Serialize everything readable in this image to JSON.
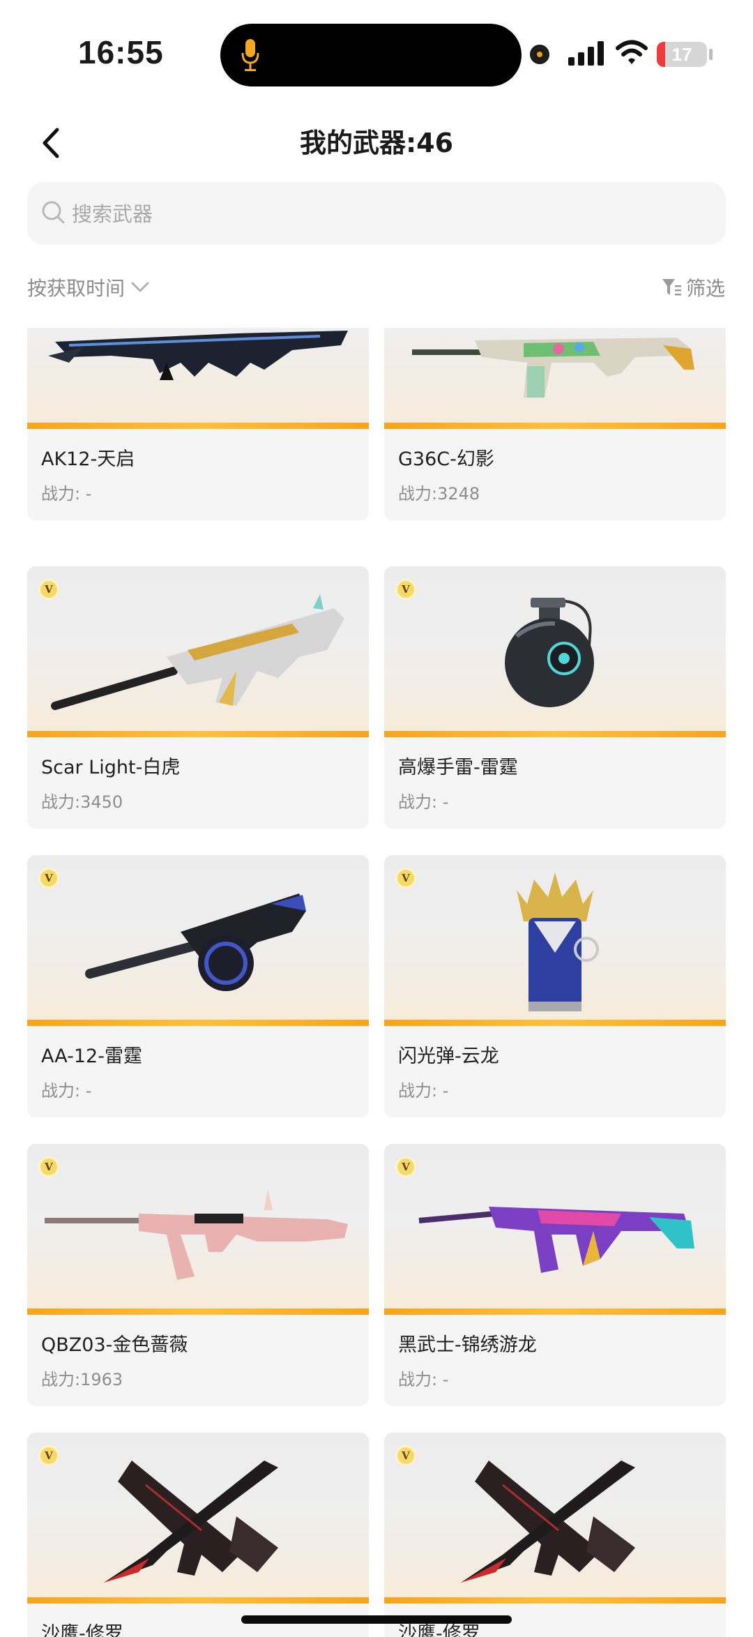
{
  "status_bar": {
    "time": "16:55",
    "battery": "17",
    "battery_level": 0.17
  },
  "header": {
    "title": "我的武器:46"
  },
  "search": {
    "placeholder": "搜索武器"
  },
  "toolbar": {
    "sort_label": "按获取时间",
    "filter_label": "筛选"
  },
  "weapons": [
    {
      "name": "AK12-天启",
      "power": "战力: -",
      "vip": false,
      "icon": "rifle-dark-icon"
    },
    {
      "name": "G36C-幻影",
      "power": "战力:3248",
      "vip": false,
      "icon": "rifle-colorful-icon"
    },
    {
      "name": "Scar Light-白虎",
      "power": "战力:3450",
      "vip": true,
      "icon": "rifle-white-tiger-icon"
    },
    {
      "name": "高爆手雷-雷霆",
      "power": "战力: -",
      "vip": true,
      "icon": "grenade-icon"
    },
    {
      "name": "AA-12-雷霆",
      "power": "战力: -",
      "vip": true,
      "icon": "shotgun-drum-icon"
    },
    {
      "name": "闪光弹-云龙",
      "power": "战力: -",
      "vip": true,
      "icon": "flashbang-icon"
    },
    {
      "name": "QBZ03-金色蔷薇",
      "power": "战力:1963",
      "vip": true,
      "icon": "rifle-pink-icon"
    },
    {
      "name": "黑武士-锦绣游龙",
      "power": "战力: -",
      "vip": true,
      "icon": "rifle-dragon-icon"
    },
    {
      "name": "沙鹰-修罗",
      "power": "",
      "vip": true,
      "icon": "dual-pistol-icon"
    },
    {
      "name": "沙鹰-修罗",
      "power": "",
      "vip": true,
      "icon": "dual-pistol-icon"
    }
  ],
  "vip_badge": "V"
}
